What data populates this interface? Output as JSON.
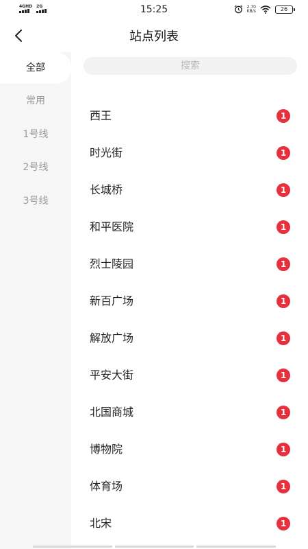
{
  "status_bar": {
    "network_1": "4GHD",
    "network_2": "2G",
    "time": "15:25",
    "speed_value": "2.70",
    "speed_unit": "KB/s",
    "battery": "26",
    "icons": [
      "alarm-icon",
      "wifi-icon",
      "battery-icon",
      "signal-icon"
    ]
  },
  "header": {
    "title": "站点列表",
    "back_icon": "chevron-left-icon"
  },
  "sidebar": {
    "items": [
      {
        "label": "全部",
        "active": true
      },
      {
        "label": "常用",
        "active": false
      },
      {
        "label": "1号线",
        "active": false
      },
      {
        "label": "2号线",
        "active": false
      },
      {
        "label": "3号线",
        "active": false
      }
    ]
  },
  "search": {
    "placeholder": "搜索",
    "value": ""
  },
  "stations": [
    {
      "name": "西王",
      "badge": "1"
    },
    {
      "name": "时光街",
      "badge": "1"
    },
    {
      "name": "长城桥",
      "badge": "1"
    },
    {
      "name": "和平医院",
      "badge": "1"
    },
    {
      "name": "烈士陵园",
      "badge": "1"
    },
    {
      "name": "新百广场",
      "badge": "1"
    },
    {
      "name": "解放广场",
      "badge": "1"
    },
    {
      "name": "平安大街",
      "badge": "1"
    },
    {
      "name": "北国商城",
      "badge": "1"
    },
    {
      "name": "博物院",
      "badge": "1"
    },
    {
      "name": "体育场",
      "badge": "1"
    },
    {
      "name": "北宋",
      "badge": "1"
    }
  ],
  "colors": {
    "badge": "#e8303c",
    "sidebar_bg": "#f6f6f6",
    "search_bg": "#f2f2f2"
  }
}
